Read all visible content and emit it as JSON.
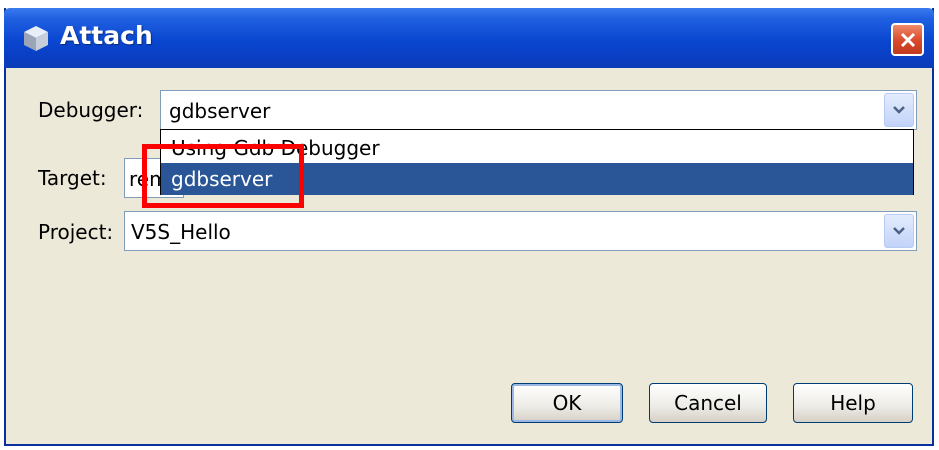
{
  "window": {
    "title": "Attach",
    "title_icon": "cube-icon",
    "close_icon": "close-icon"
  },
  "fields": {
    "debugger_label": "Debugger:",
    "debugger_value": "gdbserver",
    "target_label": "Target:",
    "target_value": "rem",
    "project_label": "Project:",
    "project_value": "V5S_Hello"
  },
  "dropdown": {
    "items": [
      {
        "label": "Using Gdb Debugger",
        "selected": false
      },
      {
        "label": "gdbserver",
        "selected": true
      }
    ]
  },
  "buttons": {
    "ok": "OK",
    "cancel": "Cancel",
    "help": "Help"
  },
  "colors": {
    "title_bar": "#0a46d0",
    "selection": "#2a5597",
    "highlight_box": "#ff0000",
    "dialog_bg": "#ece9d8"
  }
}
